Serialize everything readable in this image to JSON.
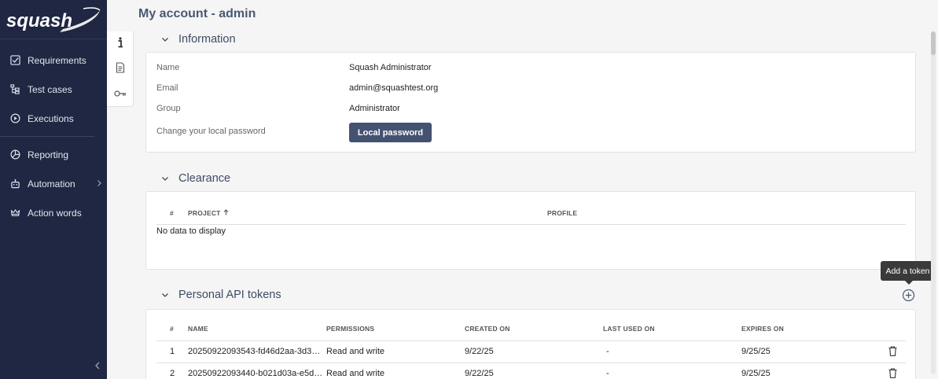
{
  "app": {
    "logo_text": "squash"
  },
  "sidebar": {
    "items": [
      {
        "label": "Requirements",
        "icon": "checkbox-icon"
      },
      {
        "label": "Test cases",
        "icon": "tree-icon"
      },
      {
        "label": "Executions",
        "icon": "play-circle-icon"
      },
      {
        "label": "Reporting",
        "icon": "pie-chart-icon"
      },
      {
        "label": "Automation",
        "icon": "robot-icon"
      },
      {
        "label": "Action words",
        "icon": "crown-icon"
      }
    ]
  },
  "page": {
    "title": "My account - admin"
  },
  "information": {
    "title": "Information",
    "fields": [
      {
        "label": "Name",
        "value": "Squash Administrator"
      },
      {
        "label": "Email",
        "value": "admin@squashtest.org"
      },
      {
        "label": "Group",
        "value": "Administrator"
      }
    ],
    "password_label": "Change your local password",
    "password_button": "Local password"
  },
  "clearance": {
    "title": "Clearance",
    "columns": {
      "index": "#",
      "project": "PROJECT",
      "profile": "PROFILE"
    },
    "empty": "No data to display"
  },
  "tokens": {
    "title": "Personal API tokens",
    "tooltip": "Add a token",
    "columns": {
      "index": "#",
      "name": "NAME",
      "permissions": "PERMISSIONS",
      "created": "CREATED ON",
      "last_used": "LAST USED ON",
      "expires": "EXPIRES ON"
    },
    "rows": [
      {
        "index": "1",
        "name": "20250922093543-fd46d2aa-3d3…",
        "permissions": "Read and write",
        "created": "9/22/25",
        "last_used": "-",
        "expires": "9/25/25"
      },
      {
        "index": "2",
        "name": "20250922093440-b021d03a-e5d…",
        "permissions": "Read and write",
        "created": "9/22/25",
        "last_used": "-",
        "expires": "9/25/25"
      }
    ]
  }
}
